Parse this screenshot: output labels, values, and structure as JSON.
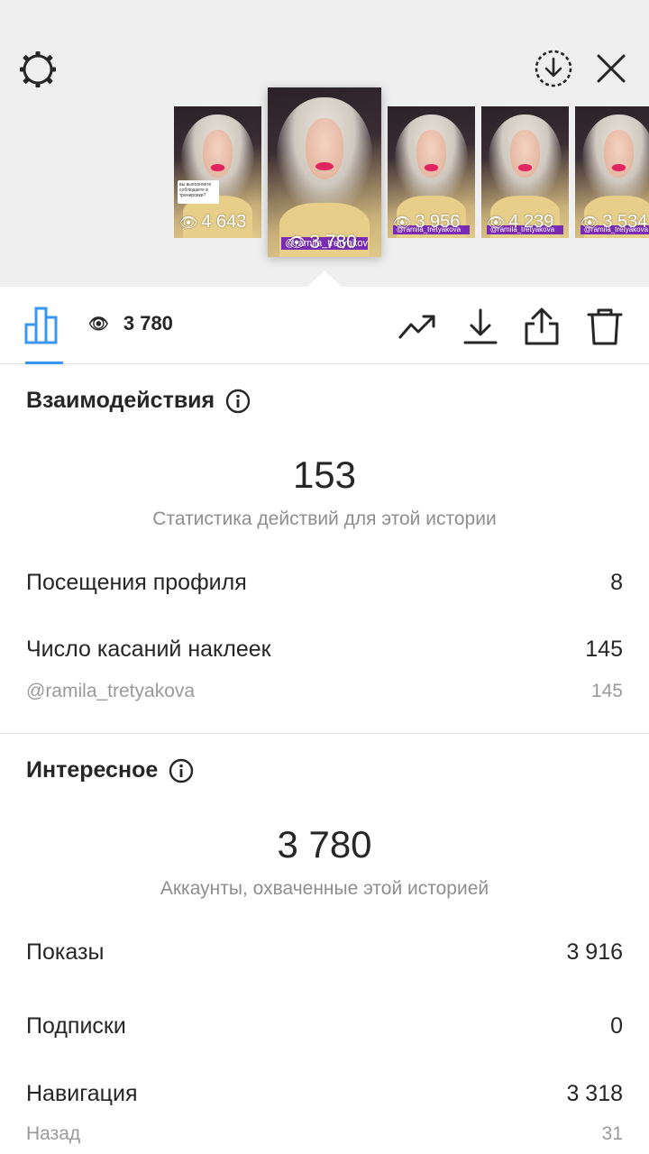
{
  "header": {
    "icons": [
      "settings-icon",
      "download-circle-icon",
      "close-icon"
    ]
  },
  "stories": [
    {
      "views": "4 643",
      "has_poll": true,
      "poll_text": "вы выполняете соблюдаете в тренировки?"
    },
    {
      "views": "3 780",
      "current": true,
      "tag": "@ramila_tretyakova"
    },
    {
      "views": "3 956",
      "tag": "@ramila_tretyakova"
    },
    {
      "views": "4 239",
      "tag": "@ramila_tretyakova"
    },
    {
      "views": "3 534",
      "tag": "@ramila_tretyakova"
    }
  ],
  "toolbar": {
    "views": "3 780",
    "accent_color": "#3897f0",
    "icons": [
      "bar-chart-icon",
      "eye-icon",
      "trending-icon",
      "download-icon",
      "share-icon",
      "trash-icon"
    ]
  },
  "interactions": {
    "title": "Взаимодействия",
    "total": "153",
    "caption": "Статистика действий для этой истории",
    "rows": [
      {
        "label": "Посещения профиля",
        "value": "8"
      },
      {
        "label": "Число касаний наклеек",
        "value": "145"
      },
      {
        "label": "@ramila_tretyakova",
        "value": "145",
        "sub": true
      }
    ]
  },
  "discovery": {
    "title": "Интересное",
    "total": "3 780",
    "caption": "Аккаунты, охваченные этой историей",
    "rows": [
      {
        "label": "Показы",
        "value": "3 916"
      },
      {
        "label": "Подписки",
        "value": "0"
      },
      {
        "label": "Навигация",
        "value": "3 318"
      },
      {
        "label": "Назад",
        "value": "31",
        "sub": true
      }
    ]
  }
}
